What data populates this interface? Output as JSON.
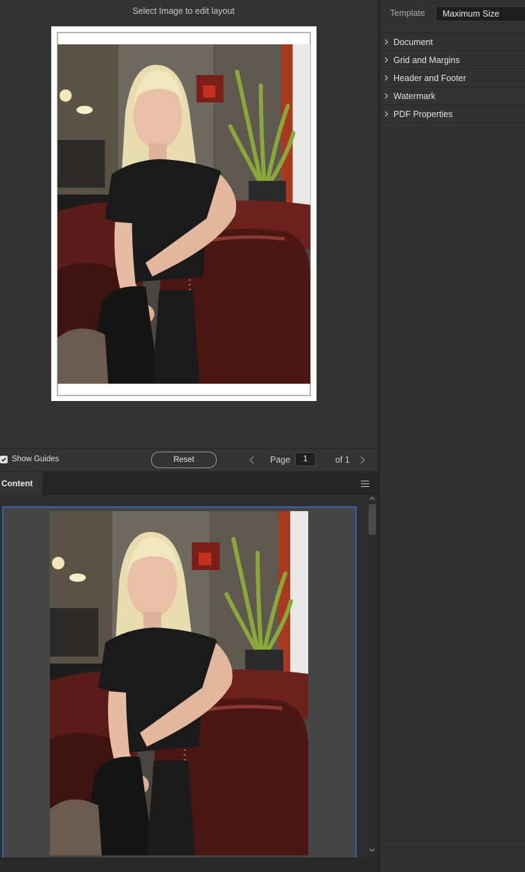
{
  "preview": {
    "title": "Select Image to edit layout"
  },
  "toolbar": {
    "show_guides_label": "Show Guides",
    "show_guides_checked": true,
    "reset_label": "Reset",
    "page_label": "Page",
    "page_value": "1",
    "of_label": "of 1"
  },
  "content_panel": {
    "tab_label": "Content"
  },
  "right_panel": {
    "template_label": "Template",
    "template_value": "Maximum Size",
    "sections": [
      {
        "label": "Document"
      },
      {
        "label": "Grid and Margins"
      },
      {
        "label": "Header and Footer"
      },
      {
        "label": "Watermark"
      },
      {
        "label": "PDF Properties"
      }
    ]
  },
  "colors": {
    "selection_border": "#2d62b5",
    "panel_bg": "#333333"
  }
}
